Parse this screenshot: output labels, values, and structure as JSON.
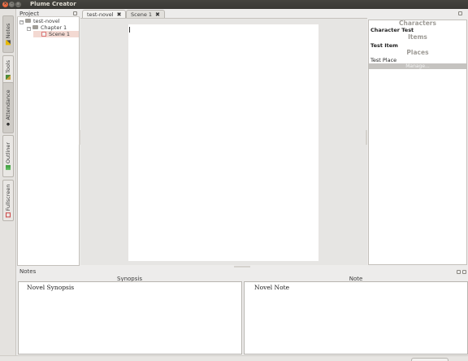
{
  "window": {
    "title": "Plume Creator",
    "close_glyph": "×",
    "min_glyph": "–",
    "max_glyph": "□"
  },
  "left_dock": {
    "tabs": [
      {
        "label": "Notes",
        "icon": "pencil-icon",
        "active": true
      },
      {
        "label": "Tools",
        "icon": "tools-icon",
        "active": false
      },
      {
        "label": "Attendance",
        "icon": "people-icon",
        "active": true
      },
      {
        "label": "Outliner",
        "icon": "outliner-icon",
        "active": false
      },
      {
        "label": "Fullscreen",
        "icon": "fullscreen-icon",
        "active": false
      }
    ]
  },
  "project": {
    "title": "Project",
    "tree": [
      {
        "label": "test-novel",
        "level": 0,
        "toggle": "−"
      },
      {
        "label": "Chapter 1",
        "level": 1,
        "toggle": "−"
      },
      {
        "label": "Scene 1",
        "level": 2,
        "selected": true
      }
    ]
  },
  "tabs": [
    {
      "label": "test-novel",
      "close": "✖",
      "active": true
    },
    {
      "label": "Scene 1",
      "close": "✖",
      "active": false
    }
  ],
  "attendance": {
    "characters_header": "Characters",
    "character_item": "Character Test",
    "items_header": "Items",
    "item_item": "Test Item",
    "places_header": "Places",
    "place_item": "Test Place",
    "manage_label": "Manage..."
  },
  "notes": {
    "title": "Notes",
    "synopsis_label": "Synopsis",
    "note_label": "Note",
    "synopsis_text": "Novel Synopsis",
    "note_text": "Novel Note"
  },
  "colors": {
    "titlebar": "#3e3d39",
    "close_button": "#e95420",
    "selection": "#f3d9d2",
    "category_header": "#9e9b96"
  }
}
